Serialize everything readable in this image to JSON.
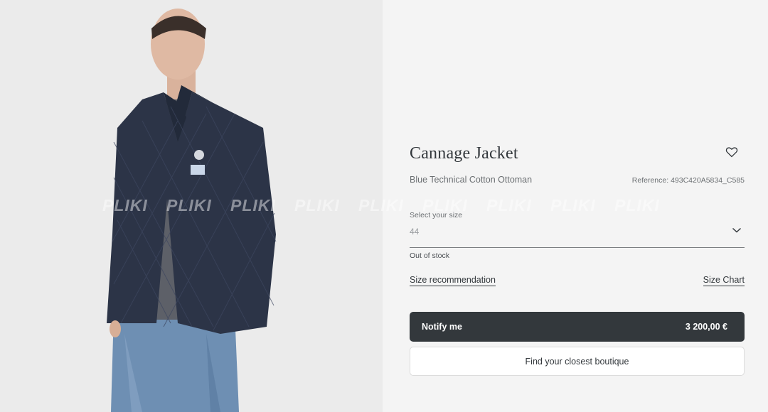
{
  "product": {
    "title": "Cannage Jacket",
    "subtitle": "Blue Technical Cotton Ottoman",
    "reference": "Reference: 493C420A5834_C585"
  },
  "size": {
    "label": "Select your size",
    "value": "44",
    "stock_status": "Out of stock"
  },
  "links": {
    "size_recommendation": "Size recommendation",
    "size_chart": "Size Chart"
  },
  "notify": {
    "label": "Notify me",
    "price": "3 200,00 €"
  },
  "boutique": {
    "label": "Find your closest boutique"
  },
  "watermark": [
    "PLIKI",
    "PLIKI",
    "PLIKI",
    "PLIKI",
    "PLIKI",
    "PLIKI",
    "PLIKI",
    "PLIKI",
    "PLIKI"
  ],
  "icons": {
    "favorite": "heart-icon",
    "dropdown": "chevron-down-icon"
  },
  "colors": {
    "primary_button": "#33383c",
    "panel_background": "#f4f4f4"
  }
}
